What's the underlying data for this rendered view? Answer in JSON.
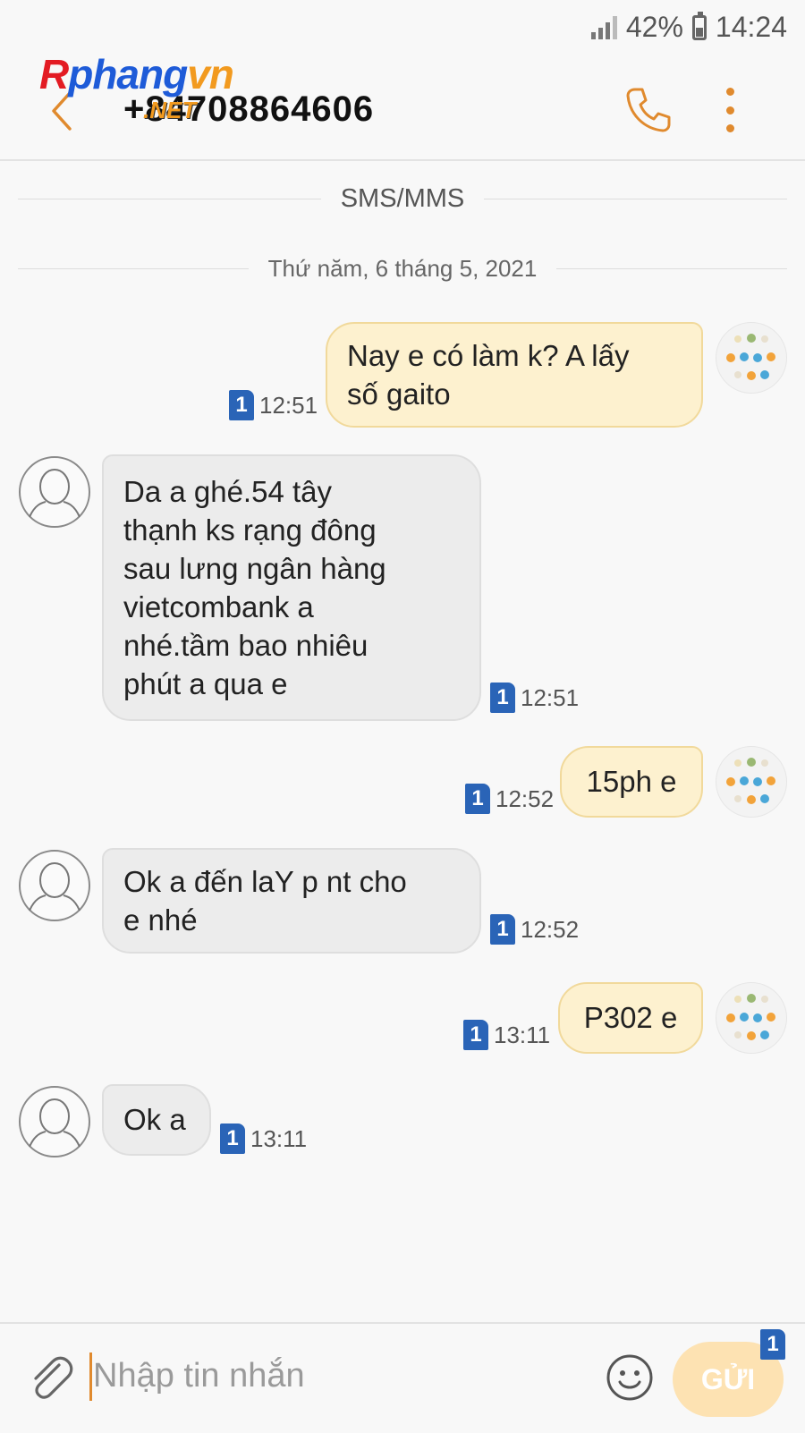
{
  "status_bar": {
    "battery": "42%",
    "time": "14:24"
  },
  "header": {
    "contact": "+84708864606",
    "watermark": {
      "r": "R",
      "p": "phang",
      "v": "vn",
      "net": ".NET"
    }
  },
  "separators": {
    "channel": "SMS/MMS",
    "date": "Thứ năm, 6 tháng 5, 2021"
  },
  "sim_label": "1",
  "messages": [
    {
      "direction": "out",
      "lines": [
        "Nay e có làm k? A lấy",
        "số gaito"
      ],
      "time": "12:51"
    },
    {
      "direction": "in",
      "lines": [
        "Da a ghé.54 tây",
        "thạnh ks rạng đông",
        "sau lưng ngân hàng",
        "vietcombank a",
        "nhé.tầm bao nhiêu",
        "phút a qua e"
      ],
      "time": "12:51"
    },
    {
      "direction": "out",
      "lines": [
        "15ph e"
      ],
      "time": "12:52"
    },
    {
      "direction": "in",
      "lines": [
        "Ok a đến laY p nt cho",
        "e nhé"
      ],
      "time": "12:52"
    },
    {
      "direction": "out",
      "lines": [
        "P302 e"
      ],
      "time": "13:11"
    },
    {
      "direction": "in",
      "lines": [
        "Ok a"
      ],
      "time": "13:11"
    }
  ],
  "compose": {
    "placeholder": "Nhập tin nhắn",
    "send_label": "GỬI"
  },
  "colors": {
    "accent": "#e08a2e",
    "sim_badge": "#2a64b7",
    "out_bubble": "#fdf1cf",
    "in_bubble": "#ececec"
  }
}
